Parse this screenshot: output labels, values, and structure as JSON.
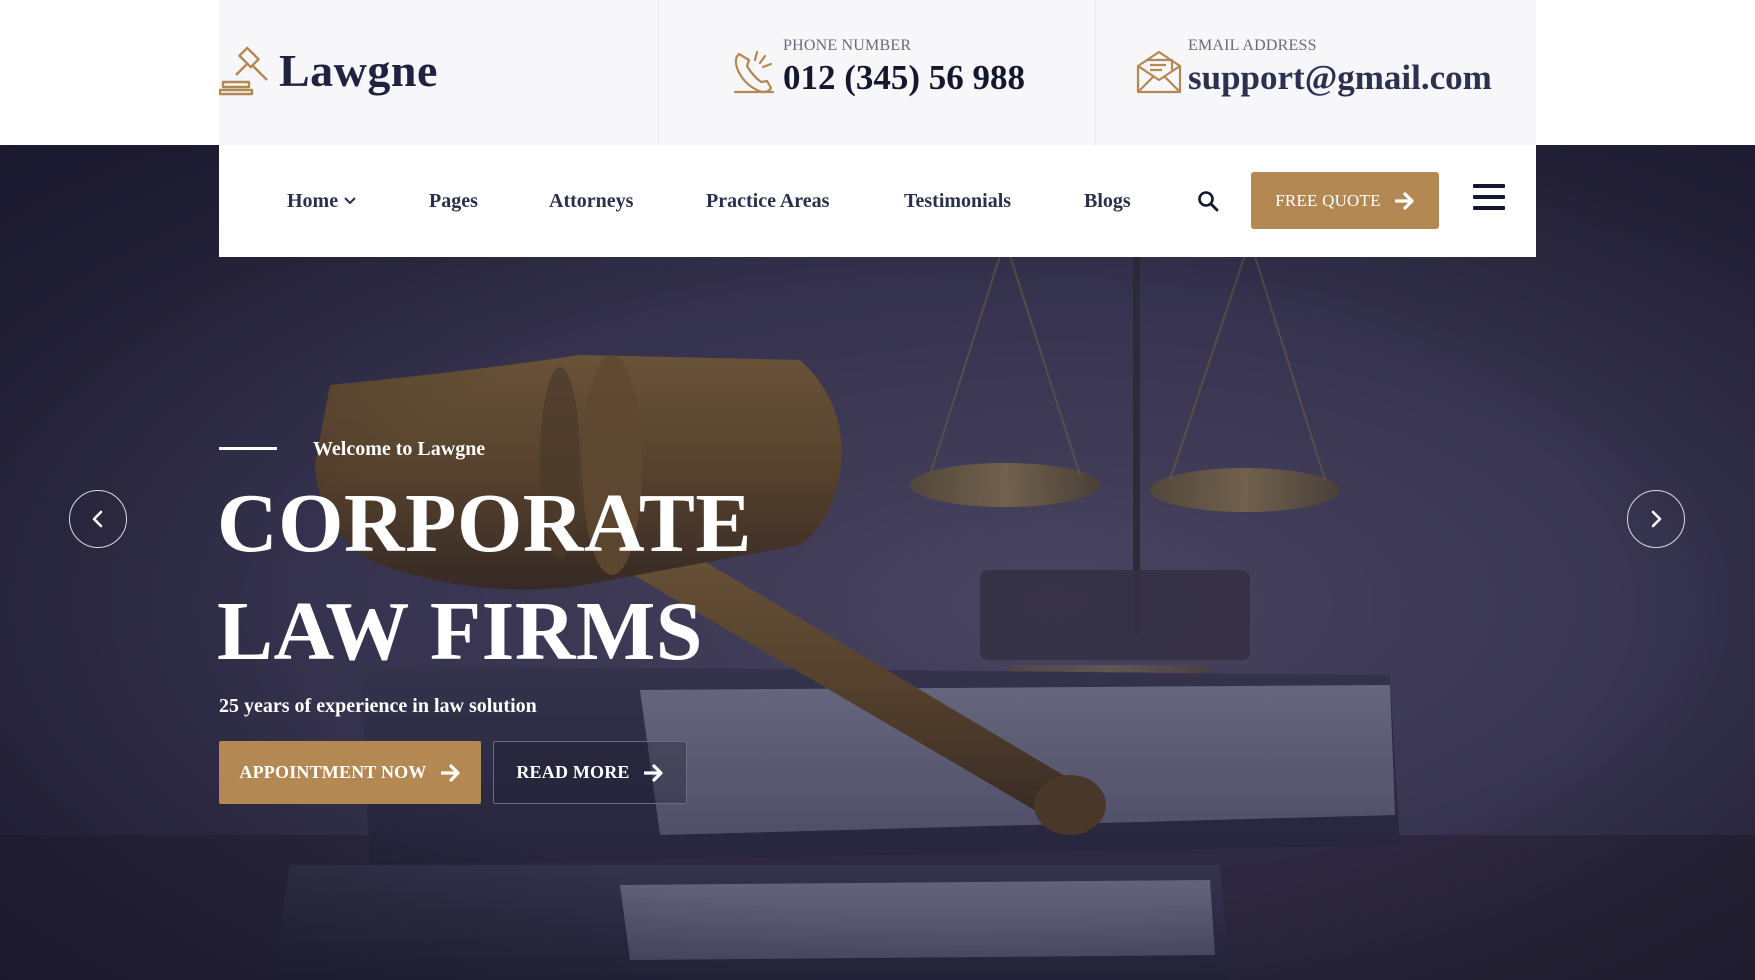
{
  "brand": {
    "name": "Lawgne",
    "accent_color": "#b38853",
    "dark_color": "#15172e"
  },
  "topbar": {
    "phone": {
      "label": "PHONE NUMBER",
      "value": "012 (345) 56 988",
      "icon": "phone-icon"
    },
    "email": {
      "label": "EMAIL ADDRESS",
      "value": "support@gmail.com",
      "icon": "envelope-icon"
    }
  },
  "nav": {
    "items": [
      {
        "label": "Home",
        "has_dropdown": true
      },
      {
        "label": "Pages"
      },
      {
        "label": "Attorneys"
      },
      {
        "label": "Practice Areas"
      },
      {
        "label": "Testimonials"
      },
      {
        "label": "Blogs"
      }
    ],
    "search_icon": "search-icon",
    "quote_button": "FREE QUOTE",
    "menu_icon": "hamburger-menu-icon"
  },
  "hero": {
    "eyebrow": "Welcome to Lawgne",
    "title_line1": "CORPORATE",
    "title_line2": "LAW FIRMS",
    "subtitle": "25 years of experience in law solution",
    "primary_button": "APPOINTMENT NOW",
    "secondary_button": "READ MORE",
    "prev_icon": "chevron-left-icon",
    "next_icon": "chevron-right-icon"
  }
}
